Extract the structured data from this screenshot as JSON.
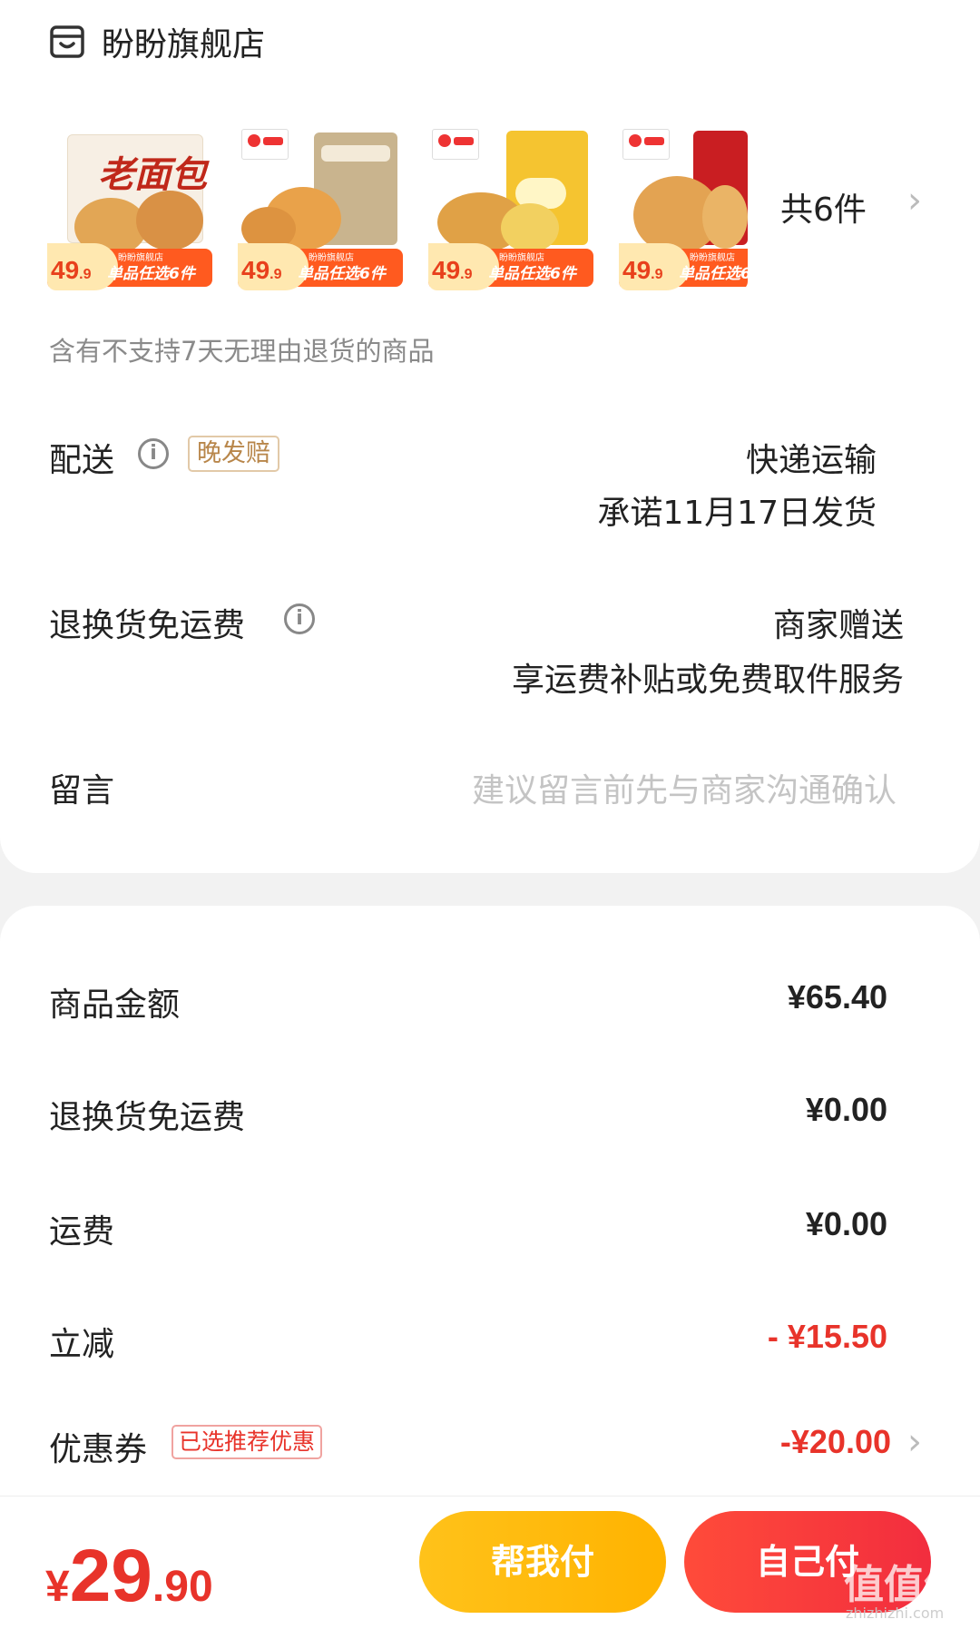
{
  "store": {
    "name": "盼盼旗舰店",
    "icon": "store-icon"
  },
  "products": {
    "items": [
      {
        "headline": "老面包",
        "price_int": "49",
        "price_dec": ".9",
        "shop_tag": "盼盼旗舰店",
        "promo": "单品任选6件"
      },
      {
        "price_int": "49",
        "price_dec": ".9",
        "shop_tag": "盼盼旗舰店",
        "promo": "单品任选6件"
      },
      {
        "price_int": "49",
        "price_dec": ".9",
        "shop_tag": "盼盼旗舰店",
        "promo": "单品任选6件"
      },
      {
        "price_int": "49",
        "price_dec": ".9",
        "shop_tag": "盼盼旗舰店",
        "promo": "单品任选6"
      }
    ],
    "count_label": "共6件",
    "notice": "含有不支持7天无理由退货的商品"
  },
  "delivery": {
    "label": "配送",
    "badge": "晚发赔",
    "method": "快递运输",
    "promise": "承诺11月17日发货"
  },
  "return_free": {
    "label": "退换货免运费",
    "provider": "商家赠送",
    "desc": "享运费补贴或免费取件服务"
  },
  "message": {
    "label": "留言",
    "placeholder": "建议留言前先与商家沟通确认"
  },
  "fees": {
    "goods_label": "商品金额",
    "goods_value": "¥65.40",
    "return_label": "退换货免运费",
    "return_value": "¥0.00",
    "shipping_label": "运费",
    "shipping_value": "¥0.00",
    "discount_label": "立减",
    "discount_value": "- ¥15.50",
    "coupon_label": "优惠券",
    "coupon_tag": "已选推荐优惠",
    "coupon_value": "-¥20.00"
  },
  "footer": {
    "currency": "¥",
    "total_int": "29",
    "total_dec": ".90",
    "help_pay": "帮我付",
    "self_pay": "自己付"
  },
  "watermark": {
    "main": "值值值",
    "sub": "zhizhizhi.com"
  },
  "colors": {
    "accent_red": "#e8332a",
    "help_yellow": "#ffc21a",
    "muted": "#8a8a8a"
  }
}
